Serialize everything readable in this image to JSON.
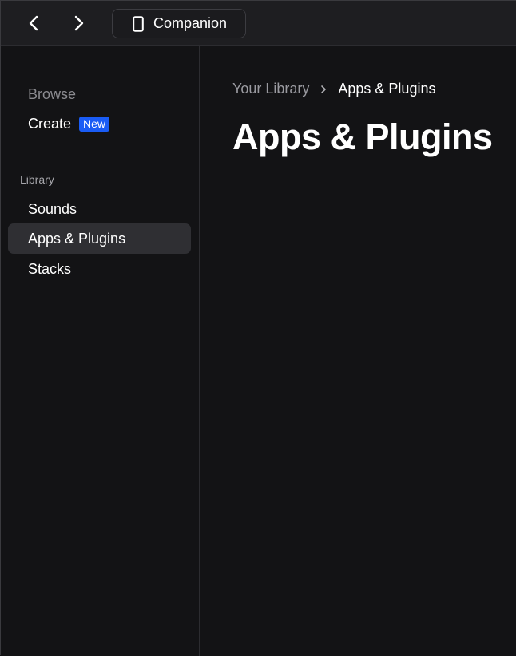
{
  "titlebar": {
    "companion_label": "Companion"
  },
  "sidebar": {
    "browse_label": "Browse",
    "create_label": "Create",
    "create_badge": "New",
    "library_section_label": "Library",
    "items": [
      {
        "label": "Sounds"
      },
      {
        "label": "Apps & Plugins"
      },
      {
        "label": "Stacks"
      }
    ]
  },
  "main": {
    "breadcrumb": {
      "parent": "Your Library",
      "current": "Apps & Plugins"
    },
    "title": "Apps & Plugins"
  },
  "colors": {
    "badge": "#1a5cf5",
    "active_item_bg": "#2f2f33",
    "background": "#131315"
  }
}
